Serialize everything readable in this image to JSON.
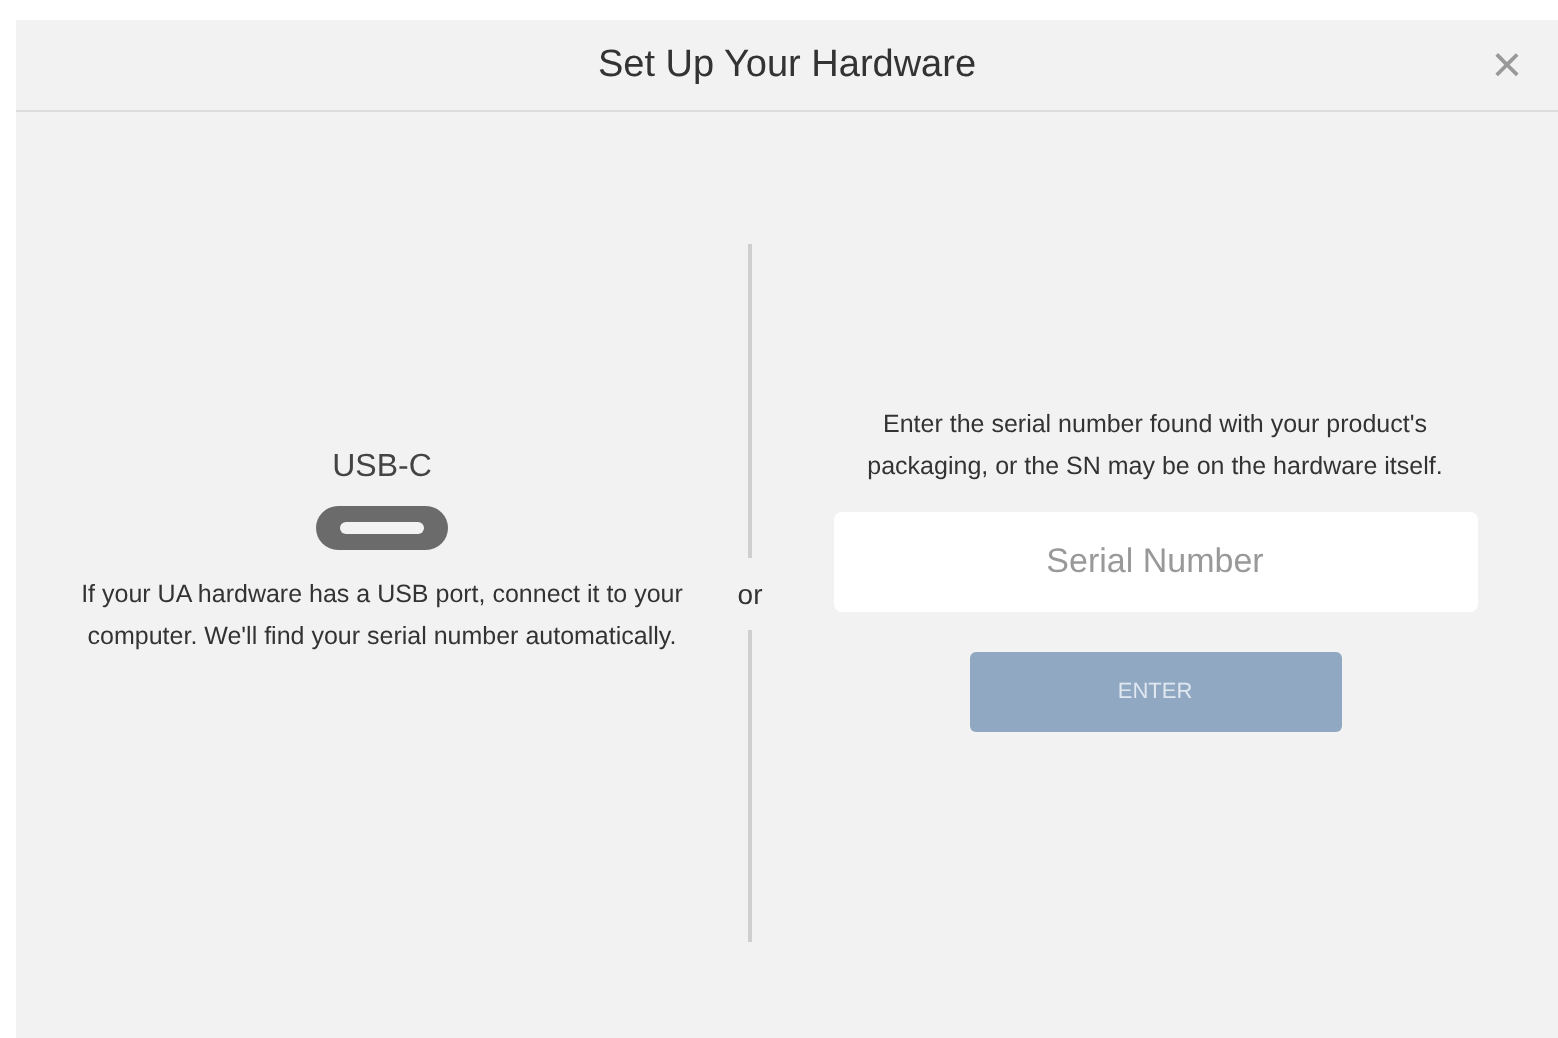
{
  "dialog": {
    "title": "Set Up Your Hardware",
    "close": "×"
  },
  "usb": {
    "label": "USB-C",
    "text": "If your UA hardware has a USB port, connect it to your computer. We'll find your serial number automatically."
  },
  "separator": "or",
  "serial": {
    "text": "Enter the serial number found with your product's packaging, or the SN may be on the hardware itself.",
    "placeholder": "Serial Number",
    "button": {
      "label": "ENTER",
      "disabled": true
    }
  }
}
